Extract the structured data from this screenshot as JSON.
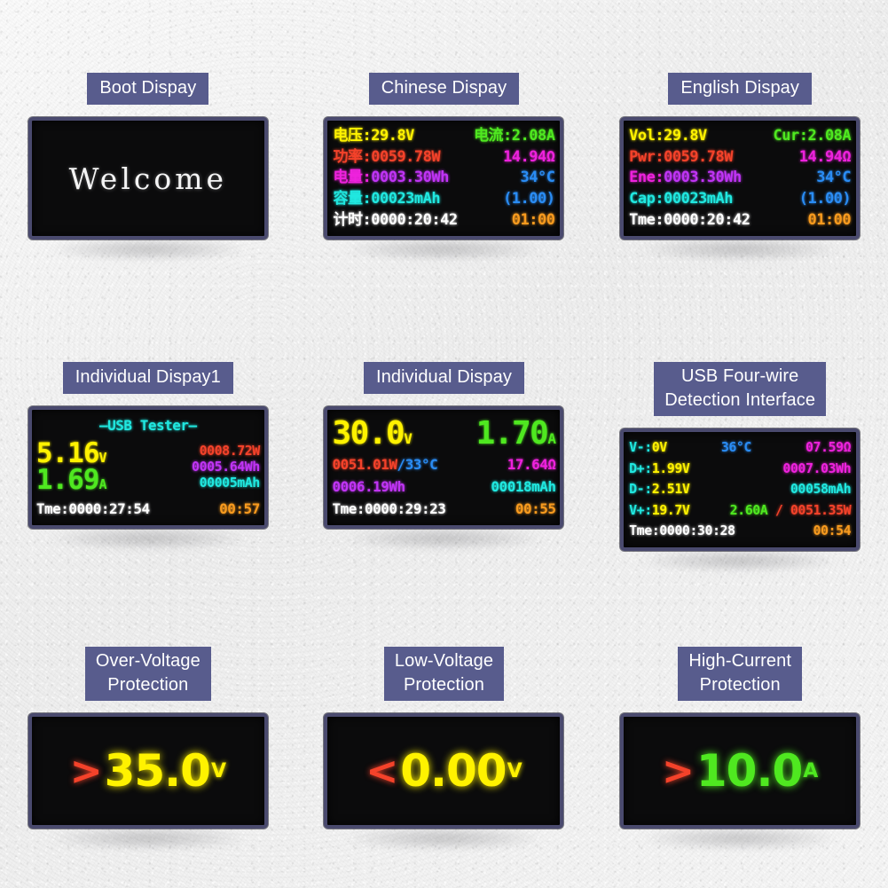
{
  "panels": [
    {
      "id": "boot-display",
      "caption": "Boot Dispay",
      "screen_type": "boot",
      "boot_text": "Welcome"
    },
    {
      "id": "chinese-display",
      "caption": "Chinese Dispay",
      "screen_type": "readout",
      "rows": [
        {
          "left_label": "电压:",
          "left_label_color": "#fff200",
          "left_value": "29.8V",
          "left_value_color": "#fff200",
          "right_value": "电流:2.08A",
          "right_value_color": "#4fe820"
        },
        {
          "left_label": "功率:",
          "left_label_color": "#f4422a",
          "left_value": "0059.78W",
          "left_value_color": "#f4422a",
          "right_value": "14.94Ω",
          "right_value_color": "#ee22dd"
        },
        {
          "left_label": "电量:",
          "left_label_color": "#ee22dd",
          "left_value": "0003.30Wh",
          "left_value_color": "#c034f5",
          "right_value": "34°C",
          "right_value_color": "#2a8cf4"
        },
        {
          "left_label": "容量:",
          "left_label_color": "#20e8e0",
          "left_value": "00023mAh",
          "left_value_color": "#20e8e0",
          "right_value": "(1.00)",
          "right_value_color": "#2a8cf4"
        },
        {
          "left_label": "计时:",
          "left_label_color": "#ffffff",
          "left_value": "0000:20:42",
          "left_value_color": "#ffffff",
          "right_value": "01:00",
          "right_value_color": "#f79a1e"
        }
      ]
    },
    {
      "id": "english-display",
      "caption": "English Dispay",
      "screen_type": "readout",
      "rows": [
        {
          "left_label": "Vol:",
          "left_label_color": "#fff200",
          "left_value": "29.8V",
          "left_value_color": "#fff200",
          "right_value": "Cur:2.08A",
          "right_value_color": "#4fe820"
        },
        {
          "left_label": "Pwr:",
          "left_label_color": "#f4422a",
          "left_value": "0059.78W",
          "left_value_color": "#f4422a",
          "right_value": "14.94Ω",
          "right_value_color": "#ee22dd"
        },
        {
          "left_label": "Ene:",
          "left_label_color": "#ee22dd",
          "left_value": "0003.30Wh",
          "left_value_color": "#c034f5",
          "right_value": "34°C",
          "right_value_color": "#2a8cf4"
        },
        {
          "left_label": "Cap:",
          "left_label_color": "#20e8e0",
          "left_value": "00023mAh",
          "left_value_color": "#20e8e0",
          "right_value": "(1.00)",
          "right_value_color": "#2a8cf4"
        },
        {
          "left_label": "Tme:",
          "left_label_color": "#ffffff",
          "left_value": "0000:20:42",
          "left_value_color": "#ffffff",
          "right_value": "01:00",
          "right_value_color": "#f79a1e"
        }
      ]
    },
    {
      "id": "individual-display-1",
      "caption": "Individual Dispay1",
      "screen_type": "individual1",
      "title": "—USB Tester—",
      "voltage": "5.16",
      "voltage_unit": "V",
      "current": "1.69",
      "current_unit": "A",
      "power": "0008.72W",
      "energy": "0005.64Wh",
      "capacity": "00005mAh",
      "time_label": "Tme:",
      "time_value": "0000:27:54",
      "timer": "00:57"
    },
    {
      "id": "individual-display",
      "caption": "Individual Dispay",
      "screen_type": "individual2",
      "voltage": "30.0",
      "voltage_unit": "V",
      "current": "1.70",
      "current_unit": "A",
      "power_temp_power": "0051.01W",
      "power_temp_sep": "/",
      "power_temp_temp": "33°C",
      "resistance": "17.64Ω",
      "energy": "0006.19Wh",
      "capacity": "00018mAh",
      "time_label": "Tme:",
      "time_value": "0000:29:23",
      "timer": "00:55"
    },
    {
      "id": "usb-four-wire",
      "caption": "USB Four-wire\nDetection Interface",
      "screen_type": "fourwire",
      "rows": [
        {
          "label": "V-:",
          "value": "0V",
          "mid": "36°C",
          "right": "07.59Ω"
        },
        {
          "label": "D+:",
          "value": "1.99V",
          "mid": "",
          "right": "0007.03Wh"
        },
        {
          "label": "D-:",
          "value": "2.51V",
          "mid": "",
          "right": "00058mAh"
        },
        {
          "label": "V+:",
          "value": "19.7V",
          "mid": "2.60A",
          "mid_sep": "/",
          "right": "0051.35W"
        }
      ],
      "time_label": "Tme:",
      "time_value": "0000:30:28",
      "timer": "00:54"
    },
    {
      "id": "over-voltage-protection",
      "caption": "Over-Voltage\nProtection",
      "screen_type": "protection",
      "comparator": ">",
      "comparator_color": "#f4422a",
      "value": "35.0",
      "value_color": "#fff200",
      "unit": "V"
    },
    {
      "id": "low-voltage-protection",
      "caption": "Low-Voltage\nProtection",
      "screen_type": "protection",
      "comparator": "<",
      "comparator_color": "#f4422a",
      "value": "0.00",
      "value_color": "#fff200",
      "unit": "V"
    },
    {
      "id": "high-current-protection",
      "caption": "High-Current\nProtection",
      "screen_type": "protection",
      "comparator": ">",
      "comparator_color": "#f4422a",
      "value": "10.0",
      "value_color": "#4fe820",
      "unit": "A"
    }
  ],
  "theme": {
    "badge_bg": "#585c8d",
    "badge_text": "#ffffff",
    "screen_bg": "#0b0b0c",
    "bezel": "#4a4a6e",
    "background": "#f4f4f4"
  }
}
